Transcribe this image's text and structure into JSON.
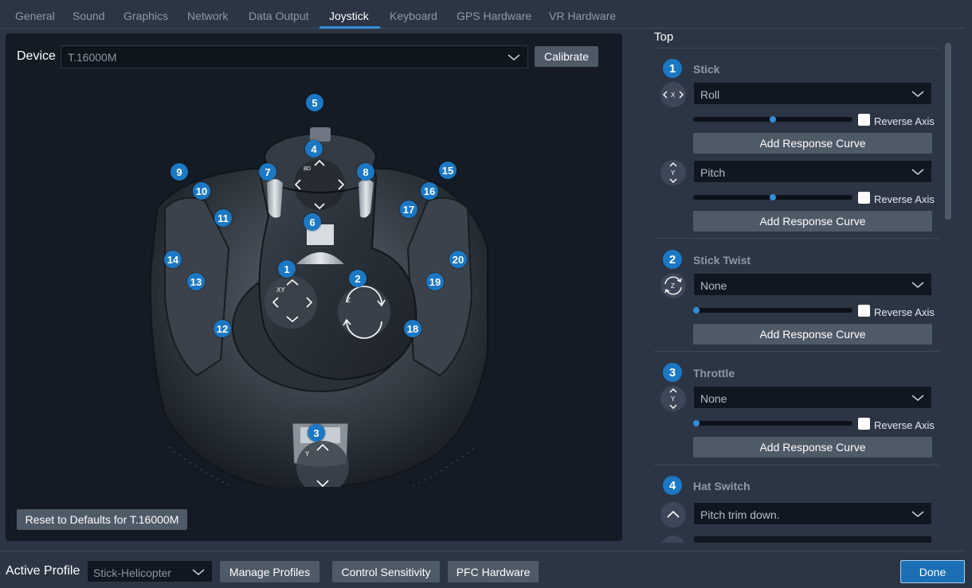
{
  "tabs": [
    {
      "label": "General"
    },
    {
      "label": "Sound"
    },
    {
      "label": "Graphics"
    },
    {
      "label": "Network"
    },
    {
      "label": "Data Output"
    },
    {
      "label": "Joystick"
    },
    {
      "label": "Keyboard"
    },
    {
      "label": "GPS Hardware"
    },
    {
      "label": "VR Hardware"
    }
  ],
  "active_tab": "Joystick",
  "device": {
    "label": "Device",
    "value": "T.16000M",
    "calibrate_label": "Calibrate",
    "reset_label": "Reset to Defaults for T.16000M"
  },
  "callouts": [
    "1",
    "2",
    "3",
    "4",
    "5",
    "6",
    "7",
    "8",
    "9",
    "10",
    "11",
    "12",
    "13",
    "14",
    "15",
    "16",
    "17",
    "18",
    "19",
    "20"
  ],
  "joystick_axis_labels": {
    "xy": "XY",
    "z": "Z",
    "y": "Y",
    "hat": "8D"
  },
  "right": {
    "section_title": "Top",
    "reverse_axis_label": "Reverse Axis",
    "response_curve_label": "Add Response Curve",
    "sections": [
      {
        "number": "1",
        "title": "Stick",
        "rows": [
          {
            "icon": "x-axis-icon",
            "axis_label": "X",
            "value": "Roll",
            "slider": 0.5
          },
          {
            "icon": "y-axis-icon",
            "axis_label": "Y",
            "value": "Pitch",
            "slider": 0.5
          }
        ]
      },
      {
        "number": "2",
        "title": "Stick Twist",
        "rows": [
          {
            "icon": "z-twist-icon",
            "axis_label": "Z",
            "value": "None",
            "slider": 0.0
          }
        ]
      },
      {
        "number": "3",
        "title": "Throttle",
        "rows": [
          {
            "icon": "y-axis-icon",
            "axis_label": "Y",
            "value": "None",
            "slider": 0.0
          }
        ]
      },
      {
        "number": "4",
        "title": "Hat Switch",
        "rows": [
          {
            "icon": "hat-up-icon",
            "value": "Pitch trim down."
          }
        ]
      }
    ]
  },
  "bottom": {
    "active_profile_label": "Active Profile",
    "profile_value": "Stick-Helicopter",
    "manage_profiles_label": "Manage Profiles",
    "control_sensitivity_label": "Control Sensitivity",
    "pfc_hardware_label": "PFC Hardware",
    "done_label": "Done"
  },
  "colors": {
    "background": "#2b3544",
    "panel": "#141b25",
    "accent": "#1b78c4",
    "button": "#4f5a67"
  }
}
